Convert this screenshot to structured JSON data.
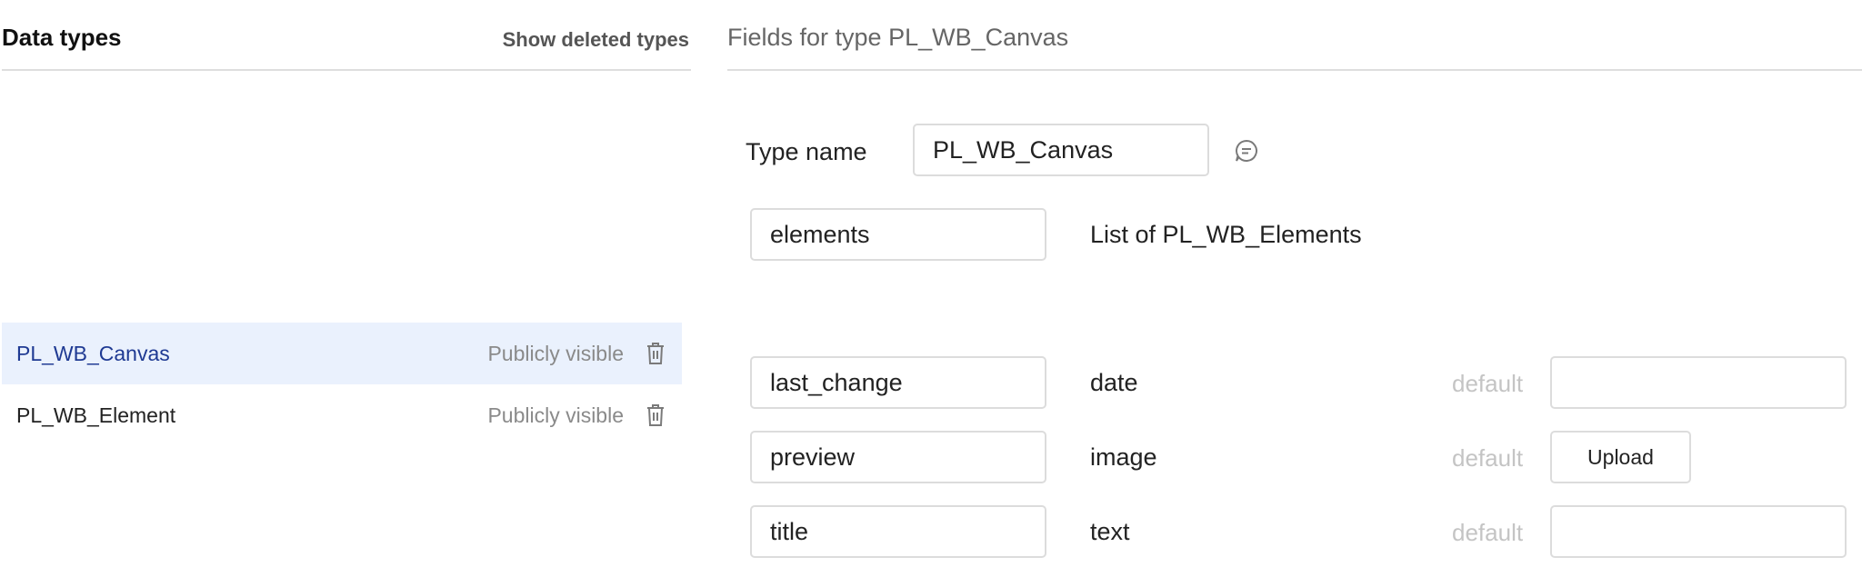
{
  "left": {
    "title": "Data types",
    "show_deleted": "Show deleted types",
    "types": [
      {
        "name": "PL_WB_Canvas",
        "visibility": "Publicly visible",
        "selected": true
      },
      {
        "name": "PL_WB_Element",
        "visibility": "Publicly visible",
        "selected": false
      }
    ]
  },
  "right": {
    "title": "Fields for type PL_WB_Canvas",
    "type_name_label": "Type name",
    "type_name_value": "PL_WB_Canvas",
    "fields": [
      {
        "name": "elements",
        "type": "List of PL_WB_Elements"
      },
      {
        "name": "last_change",
        "type": "date",
        "default_label": "default",
        "default_value": ""
      },
      {
        "name": "preview",
        "type": "image",
        "default_label": "default",
        "upload_label": "Upload"
      },
      {
        "name": "title",
        "type": "text",
        "default_label": "default",
        "default_value": ""
      }
    ]
  },
  "colors": {
    "selected_row_bg": "#eaf1fd",
    "selected_text": "#1f3a93",
    "border": "#dcdcdc",
    "muted": "#8a8a8a"
  },
  "icons": [
    "trash-icon",
    "comment-icon"
  ]
}
